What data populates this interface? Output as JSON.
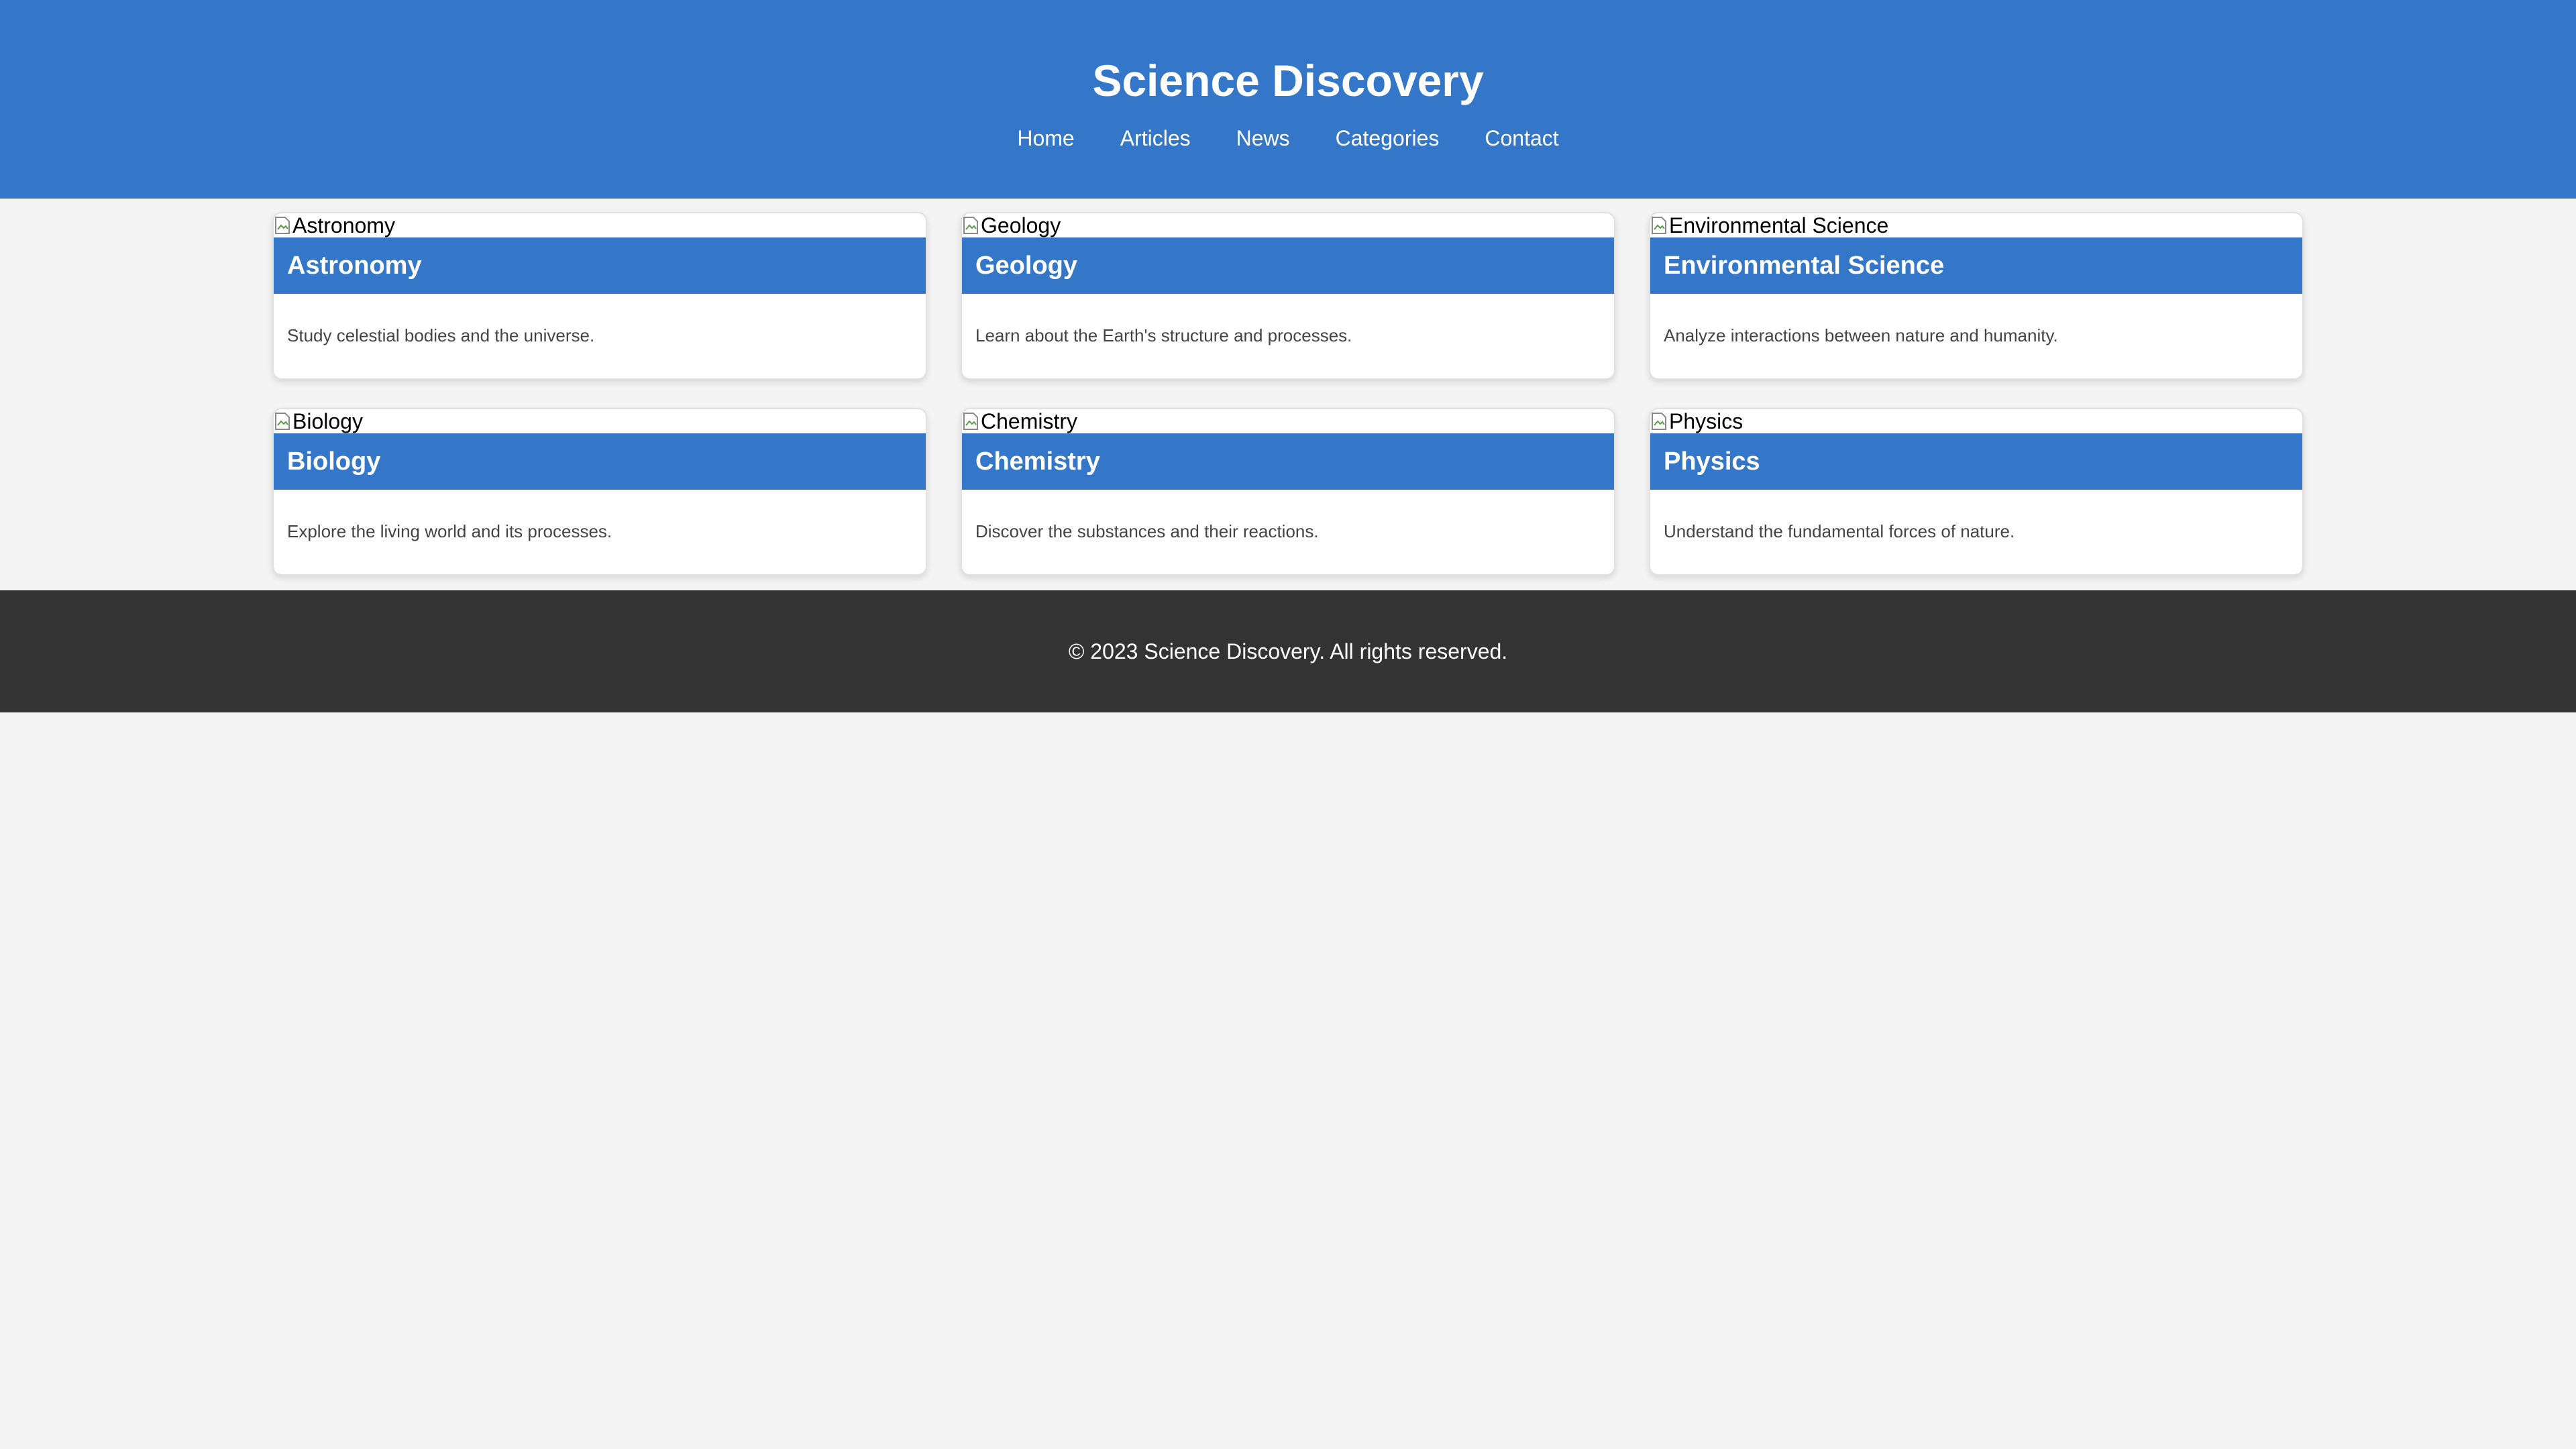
{
  "header": {
    "title": "Science Discovery",
    "background_color": "#3477c9"
  },
  "nav": {
    "items": [
      {
        "label": "Home"
      },
      {
        "label": "Articles"
      },
      {
        "label": "News"
      },
      {
        "label": "Categories"
      },
      {
        "label": "Contact"
      }
    ]
  },
  "cards": [
    {
      "image_alt": "Astronomy",
      "title": "Astronomy",
      "description": "Study celestial bodies and the universe."
    },
    {
      "image_alt": "Geology",
      "title": "Geology",
      "description": "Learn about the Earth's structure and processes."
    },
    {
      "image_alt": "Environmental Science",
      "title": "Environmental Science",
      "description": "Analyze interactions between nature and humanity."
    },
    {
      "image_alt": "Biology",
      "title": "Biology",
      "description": "Explore the living world and its processes."
    },
    {
      "image_alt": "Chemistry",
      "title": "Chemistry",
      "description": "Discover the substances and their reactions."
    },
    {
      "image_alt": "Physics",
      "title": "Physics",
      "description": "Understand the fundamental forces of nature."
    }
  ],
  "footer": {
    "text": "© 2023 Science Discovery. All rights reserved.",
    "background_color": "#333333"
  },
  "icons": {
    "card_image": "broken-image-icon"
  },
  "colors": {
    "accent": "#3477c9",
    "page_background": "#f4f4f4",
    "card_background": "#ffffff"
  }
}
